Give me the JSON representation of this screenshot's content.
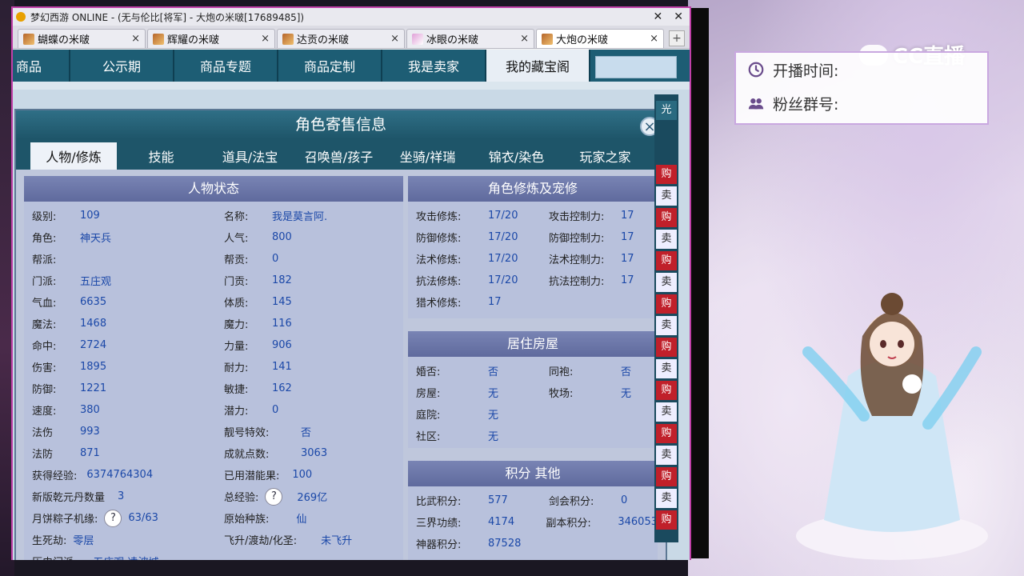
{
  "window": {
    "title": "梦幻西游 ONLINE - (无与伦比[将军] - 大炮の米啵[17689485])",
    "tabs": [
      {
        "label": "蝴蝶の米啵",
        "close": "×"
      },
      {
        "label": "辉耀の米啵",
        "close": "×"
      },
      {
        "label": "达贡の米啵",
        "close": "×"
      },
      {
        "label": "冰眼の米啵",
        "close": "×"
      },
      {
        "label": "大炮の米啵",
        "close": "×"
      }
    ],
    "add_tab": "+"
  },
  "nav": {
    "items": [
      "商品",
      "公示期",
      "商品专题",
      "商品定制",
      "我是卖家",
      "我的藏宝阁"
    ]
  },
  "dialog": {
    "title": "角色寄售信息",
    "close": "×",
    "tabs": [
      "人物/修炼",
      "技能",
      "道具/法宝",
      "召唤兽/孩子",
      "坐骑/祥瑞",
      "锦衣/染色",
      "玩家之家"
    ],
    "status": {
      "title": "人物状态",
      "left": [
        {
          "label": "级别:",
          "value": "109"
        },
        {
          "label": "角色:",
          "value": "神天兵"
        },
        {
          "label": "帮派:",
          "value": ""
        },
        {
          "label": "门派:",
          "value": "五庄观"
        },
        {
          "label": "气血:",
          "value": "6635"
        },
        {
          "label": "魔法:",
          "value": "1468"
        },
        {
          "label": "命中:",
          "value": "2724"
        },
        {
          "label": "伤害:",
          "value": "1895"
        },
        {
          "label": "防御:",
          "value": "1221"
        },
        {
          "label": "速度:",
          "value": "380"
        },
        {
          "label": "法伤",
          "value": "993"
        },
        {
          "label": "法防",
          "value": "871"
        }
      ],
      "right": [
        {
          "label": "名称:",
          "value": "我是莫言阿."
        },
        {
          "label": "人气:",
          "value": "800"
        },
        {
          "label": "帮贡:",
          "value": "0"
        },
        {
          "label": "门贡:",
          "value": "182"
        },
        {
          "label": "体质:",
          "value": "145"
        },
        {
          "label": "魔力:",
          "value": "116"
        },
        {
          "label": "力量:",
          "value": "906"
        },
        {
          "label": "耐力:",
          "value": "141"
        },
        {
          "label": "敏捷:",
          "value": "162"
        },
        {
          "label": "潜力:",
          "value": "0"
        },
        {
          "label": "靓号特效:",
          "value": "否"
        },
        {
          "label": "成就点数:",
          "value": "3063"
        }
      ],
      "extra": {
        "exp_label": "获得经验:",
        "exp_value": "6374764304",
        "potential_label": "已用潜能果:",
        "potential_value": "100",
        "qianyuan_label": "新版乾元丹数量",
        "qianyuan_value": "3",
        "total_exp_label": "总经验:",
        "total_exp_value": "269亿",
        "zongzi_label": "月饼粽子机缘:",
        "zongzi_value": "63/63",
        "race_label": "原始种族:",
        "race_value": "仙",
        "shengsi_label": "生死劫:",
        "shengsi_value": "零层",
        "feisheng_label": "飞升/渡劫/化圣:",
        "feisheng_value": "未飞升",
        "history_label": "历史门派:",
        "history_value": "五庄观,凌波城",
        "help": "?"
      }
    },
    "cultivation": {
      "title": "角色修炼及宠修",
      "rows": [
        {
          "l1": "攻击修炼:",
          "v1": "17/20",
          "l2": "攻击控制力:",
          "v2": "17"
        },
        {
          "l1": "防御修炼:",
          "v1": "17/20",
          "l2": "防御控制力:",
          "v2": "17"
        },
        {
          "l1": "法术修炼:",
          "v1": "17/20",
          "l2": "法术控制力:",
          "v2": "17"
        },
        {
          "l1": "抗法修炼:",
          "v1": "17/20",
          "l2": "抗法控制力:",
          "v2": "17"
        },
        {
          "l1": "猎术修炼:",
          "v1": "17",
          "l2": "",
          "v2": ""
        }
      ]
    },
    "house": {
      "title": "居住房屋",
      "rows": [
        {
          "l1": "婚否:",
          "v1": "否",
          "l2": "同袍:",
          "v2": "否"
        },
        {
          "l1": "房屋:",
          "v1": "无",
          "l2": "牧场:",
          "v2": "无"
        },
        {
          "l1": "庭院:",
          "v1": "无",
          "l2": "",
          "v2": ""
        },
        {
          "l1": "社区:",
          "v1": "无",
          "l2": "",
          "v2": ""
        }
      ]
    },
    "points": {
      "title": "积分 其他",
      "rows": [
        {
          "l1": "比武积分:",
          "v1": "577",
          "l2": "剑会积分:",
          "v2": "0"
        },
        {
          "l1": "三界功绩:",
          "v1": "4174",
          "l2": "副本积分:",
          "v2": "346053"
        },
        {
          "l1": "神器积分:",
          "v1": "87528",
          "l2": "",
          "v2": ""
        }
      ]
    }
  },
  "edge": {
    "header": "光",
    "buttons": [
      "购",
      "卖",
      "购",
      "卖",
      "购",
      "卖",
      "购",
      "卖",
      "购",
      "卖",
      "购",
      "卖",
      "购",
      "卖",
      "购",
      "卖",
      "购"
    ]
  },
  "stream": {
    "start_label": "开播时间:",
    "fans_label": "粉丝群号:",
    "logo": "CC直播"
  }
}
